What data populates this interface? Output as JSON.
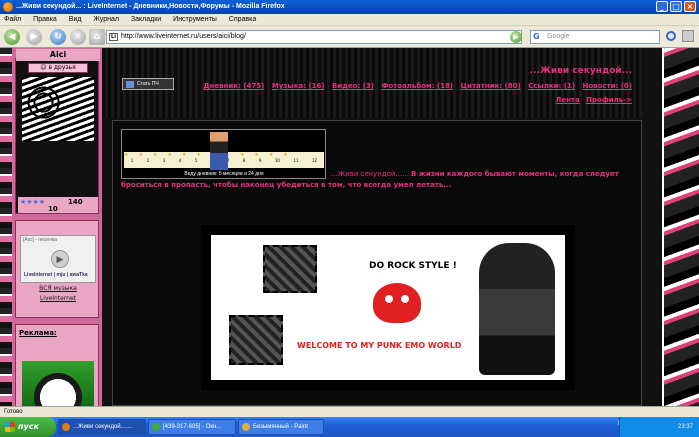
{
  "window": {
    "title": "...Живи секундой... : LiveInternet - Дневники,Новости,Форумы - Mozilla Firefox"
  },
  "menu": [
    "Файл",
    "Правка",
    "Вид",
    "Журнал",
    "Закладки",
    "Инструменты",
    "Справка"
  ],
  "nav": {
    "url": "http://www.liveinternet.ru/users/aici/blog/",
    "search_placeholder": "Google"
  },
  "sidebar": {
    "username": "Aici",
    "friends_label": "в друзья",
    "rating": "140",
    "count": "10",
    "music_title": "[Aici] - песенка",
    "music_link": "ВСЯ музыка",
    "music_link2": "LiveInternet",
    "ads_label": "Реклама:"
  },
  "header": {
    "stat_button": "Стать ПЧ",
    "blog_title": "...Живи секундой...",
    "nav_links": [
      "Дневник: (475)",
      "Музыка: (16)",
      "Видео: (3)",
      "Фотоальбом: (18)",
      "Цитатник: (80)",
      "Ссылки: (1)",
      "Новости: (0)"
    ],
    "profile_links": [
      "Лента",
      "Профиль->"
    ]
  },
  "post": {
    "ticker_caption": "Веду дневник: 5 месяцев и 24 дня",
    "ticker_numbers": [
      "1",
      "2",
      "3",
      "4",
      "5",
      "6",
      "7",
      "8",
      "9",
      "10",
      "11",
      "12"
    ],
    "text_prefix": "...Живи секундой.......",
    "text": "В жизни каждого бывают моменты, когда следует броситься в пропасть, чтобы наконец убедиться в том, что всегда умел летать...",
    "banner_title": "DO ROCK STYLE !",
    "banner_welcome": "WELCOME TO MY PUNK EMO WORLD"
  },
  "status": "Готово",
  "taskbar": {
    "start": "пуск",
    "tasks": [
      "...Живи секундой.......",
      "[439-317-605] - Окн...",
      "Безымянный - Paint"
    ],
    "lang": "EN",
    "time": "23:37"
  }
}
